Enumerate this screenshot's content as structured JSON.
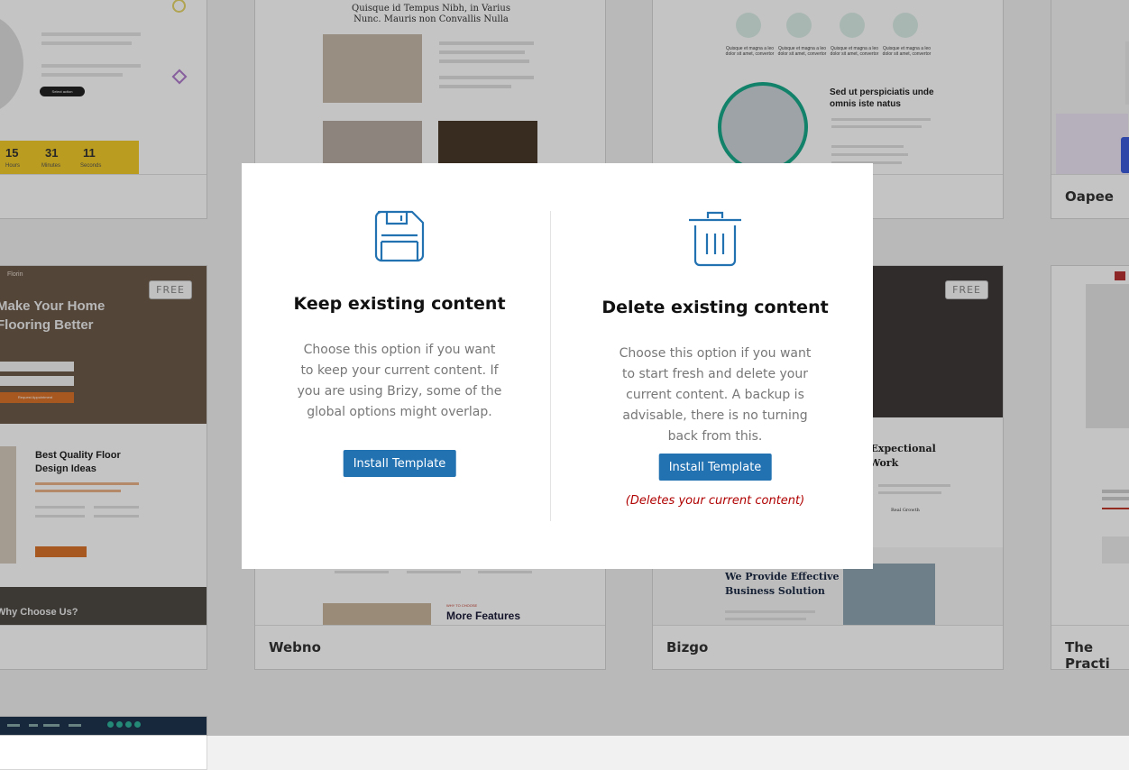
{
  "colors": {
    "accent": "#2271b1",
    "warning": "#b00000",
    "overlay": "rgba(0,0,0,0.23)"
  },
  "templates": [
    {
      "name": "",
      "countdown": [
        {
          "value": "15",
          "unit": "Hours"
        },
        {
          "value": "31",
          "unit": "Minutes"
        },
        {
          "value": "11",
          "unit": "Seconds"
        }
      ],
      "cta": "Select action"
    },
    {
      "name": "",
      "heading": "Quisque id Tempus Nibh, in Varius Nunc. Mauris non Convallis Nulla"
    },
    {
      "name": "",
      "heading": "Sed ut perspiciatis unde omnis iste natus",
      "feature": "Quisque et magna a leo dolor sit amet, convertor"
    },
    {
      "name": "Oapee"
    },
    {
      "name": "",
      "badge": "FREE",
      "brand": "Florin",
      "hero": [
        "Make Your Home",
        "Flooring Better"
      ],
      "section": [
        "Best Quality Floor",
        "Design Ideas"
      ],
      "cta": "Request Appointment",
      "footer": "Why Choose Us?"
    },
    {
      "name": "Webno",
      "heading": "More Features",
      "eyebrow": "WHY TO CHOOSE"
    },
    {
      "name": "Bizgo",
      "badge": "FREE",
      "heading": [
        "g Expectional",
        "Work"
      ],
      "section": [
        "We Provide Effective",
        "Business Solution"
      ],
      "stat": "Real Growth"
    },
    {
      "name": "The Practi"
    }
  ],
  "modal": {
    "keep": {
      "icon": "floppy-disk-icon",
      "title": "Keep existing content",
      "description": "Choose this option if you want to keep your current content. If you are using Brizy, some of the global options might overlap.",
      "button": "Install Template"
    },
    "delete": {
      "icon": "trash-icon",
      "title": "Delete existing content",
      "description": "Choose this option if you want to start fresh and delete your current content. A backup is advisable, there is no turning back from this.",
      "button": "Install Template",
      "warning": "(Deletes your current content)"
    }
  }
}
